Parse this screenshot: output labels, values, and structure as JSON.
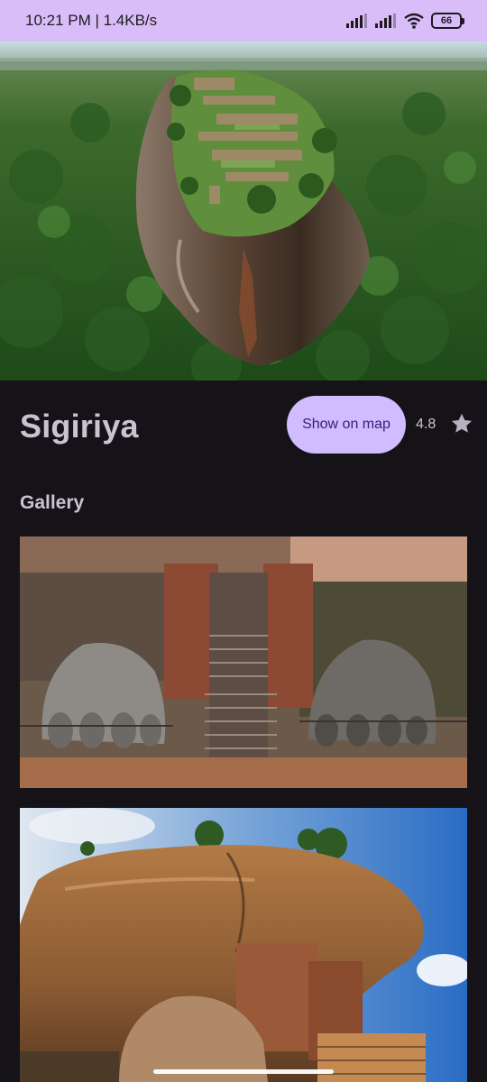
{
  "status_bar": {
    "time_speed": "10:21 PM | 1.4KB/s",
    "battery": "66",
    "icons": [
      "signal-icon",
      "signal-icon",
      "wifi-icon",
      "battery-icon"
    ]
  },
  "hero": {
    "image": "aerial-rock-fortress-image"
  },
  "place": {
    "title": "Sigiriya",
    "map_button_label": "Show on map",
    "rating": "4.8",
    "rating_icon": "star-icon"
  },
  "gallery": {
    "heading": "Gallery",
    "images": [
      "lion-paws-staircase-image",
      "rock-face-sky-image"
    ]
  },
  "colors": {
    "status_bar": "#d9bdf8",
    "background": "#151218",
    "button": "#d0bcff",
    "button_text": "#381e72",
    "text": "#cac4d0"
  }
}
